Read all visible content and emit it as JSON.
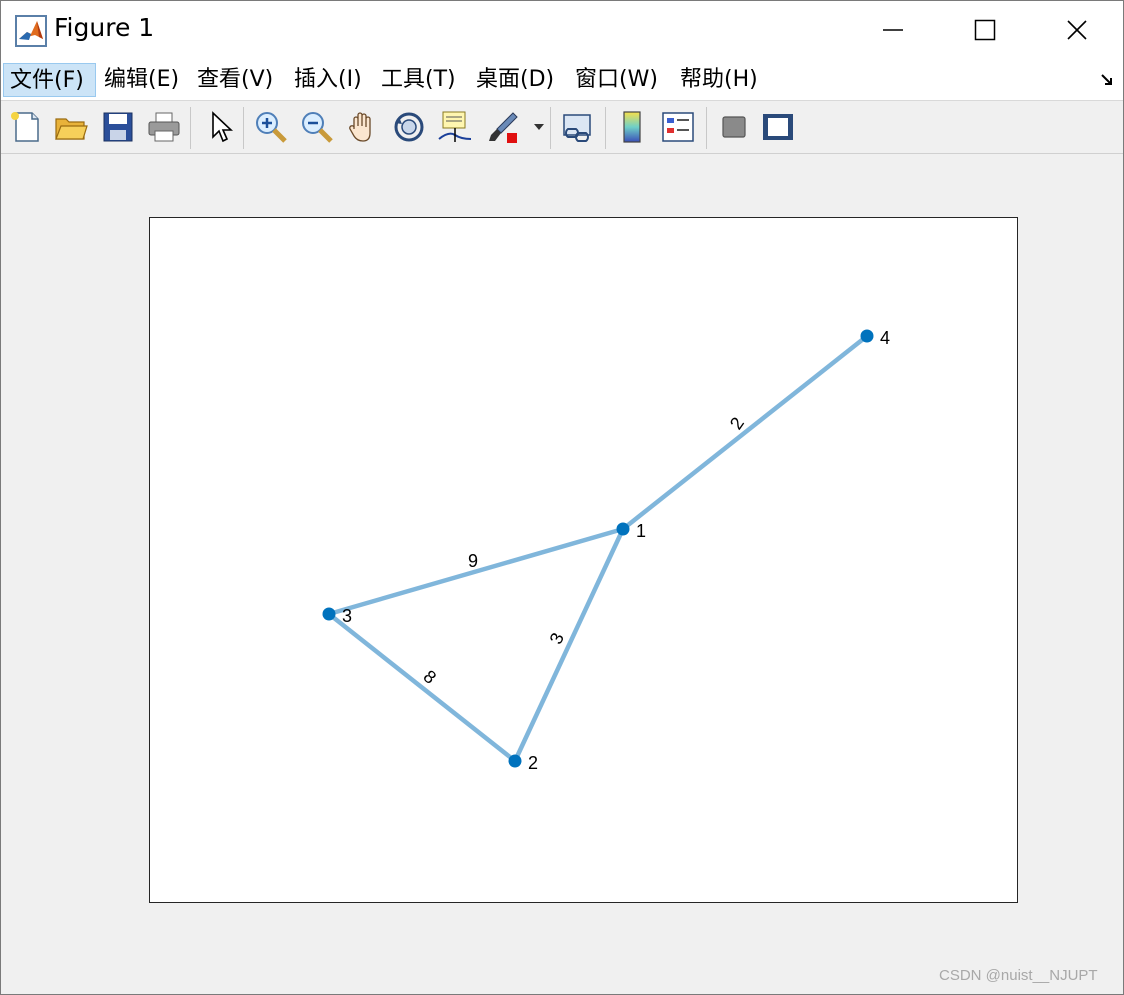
{
  "window": {
    "title": "Figure 1"
  },
  "menu": {
    "items": [
      "文件(F)",
      "编辑(E)",
      "查看(V)",
      "插入(I)",
      "工具(T)",
      "桌面(D)",
      "窗口(W)",
      "帮助(H)"
    ],
    "active_index": 0
  },
  "toolbar": {
    "buttons": [
      {
        "name": "new-figure-icon"
      },
      {
        "name": "open-file-icon"
      },
      {
        "name": "save-icon"
      },
      {
        "name": "print-icon"
      },
      {
        "name": "edit-plot-pointer-icon"
      },
      {
        "name": "zoom-in-icon"
      },
      {
        "name": "zoom-out-icon"
      },
      {
        "name": "pan-hand-icon"
      },
      {
        "name": "rotate-3d-icon"
      },
      {
        "name": "data-cursor-icon"
      },
      {
        "name": "brush-icon"
      },
      {
        "name": "link-plot-icon"
      },
      {
        "name": "insert-colorbar-icon"
      },
      {
        "name": "insert-legend-icon"
      },
      {
        "name": "hide-plot-tools-icon"
      },
      {
        "name": "show-plot-tools-icon"
      }
    ]
  },
  "graph": {
    "node_color": "#0072bd",
    "edge_color": "#80b6db",
    "nodes": [
      {
        "label": "1"
      },
      {
        "label": "2"
      },
      {
        "label": "3"
      },
      {
        "label": "4"
      }
    ],
    "edges": [
      {
        "from": "1",
        "to": "4",
        "weight": "2"
      },
      {
        "from": "1",
        "to": "3",
        "weight": "9"
      },
      {
        "from": "1",
        "to": "2",
        "weight": "3"
      },
      {
        "from": "3",
        "to": "2",
        "weight": "8"
      }
    ]
  },
  "watermark": "CSDN @nuist__NJUPT"
}
